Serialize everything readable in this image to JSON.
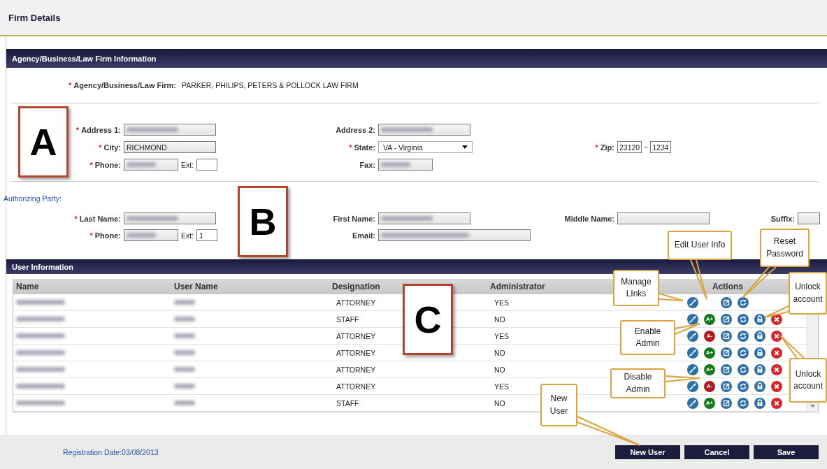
{
  "page_title": "Firm Details",
  "required_marker": "*",
  "firm_section": {
    "title": "Agency/Business/Law Firm Information",
    "firm": {
      "label": "Agency/Business/Law Firm:",
      "required": true,
      "value": "PARKER, PHILIPS, PETERS & POLLOCK LAW FIRM"
    }
  },
  "address_fields": [
    {
      "label": "Address 1:",
      "required": true,
      "kind": "text",
      "redacted": true
    },
    {
      "label": "Address 2:",
      "required": false,
      "kind": "text",
      "redacted": true
    },
    {
      "label": "City:",
      "required": true,
      "kind": "text",
      "value": "RICHMOND"
    },
    {
      "label": "State:",
      "required": true,
      "kind": "select",
      "value": "VA - Virginia"
    },
    {
      "label": "Zip:",
      "required": true,
      "kind": "zip",
      "value": "23120",
      "extension": "1234"
    },
    {
      "label": "Phone:",
      "required": true,
      "kind": "phone",
      "redacted": true,
      "ext_label": "Ext:"
    },
    {
      "label": "Fax:",
      "required": false,
      "kind": "text",
      "redacted": true
    }
  ],
  "authorizing_party": {
    "title": "Authorizing Party:",
    "fields": [
      {
        "label": "Last Name:",
        "required": true,
        "kind": "text",
        "redacted": true
      },
      {
        "label": "First Name:",
        "required": false,
        "kind": "text",
        "redacted": true
      },
      {
        "label": "Middle Name:",
        "required": false,
        "kind": "text"
      },
      {
        "label": "Suffix:",
        "required": false,
        "kind": "text"
      },
      {
        "label": "Phone:",
        "required": true,
        "kind": "phone",
        "redacted": true,
        "ext_label": "Ext:",
        "ext_value": "1"
      },
      {
        "label": "Email:",
        "required": false,
        "kind": "text",
        "redacted": true
      }
    ]
  },
  "user_section": {
    "title": "User Information",
    "columns": [
      "Name",
      "User Name",
      "Designation",
      "Administrator",
      "Actions"
    ],
    "rows": [
      {
        "name_redacted": true,
        "user_name_redacted": true,
        "designation": "ATTORNEY",
        "administrator": "YES",
        "actions": [
          {
            "kind": "link"
          },
          {
            "kind": "gap"
          },
          {
            "kind": "edit"
          },
          {
            "kind": "reset"
          }
        ]
      },
      {
        "name_redacted": true,
        "user_name_redacted": true,
        "designation": "STAFF",
        "administrator": "NO",
        "actions": [
          {
            "kind": "link"
          },
          {
            "kind": "enable_admin",
            "label": "A+"
          },
          {
            "kind": "edit"
          },
          {
            "kind": "reset"
          },
          {
            "kind": "unlock"
          },
          {
            "kind": "delete"
          }
        ]
      },
      {
        "name_redacted": true,
        "user_name_redacted": true,
        "designation": "ATTORNEY",
        "administrator": "YES",
        "actions": [
          {
            "kind": "link"
          },
          {
            "kind": "disable_admin",
            "label": "A-"
          },
          {
            "kind": "edit"
          },
          {
            "kind": "reset"
          },
          {
            "kind": "unlock"
          },
          {
            "kind": "delete"
          }
        ]
      },
      {
        "name_redacted": true,
        "user_name_redacted": true,
        "designation": "ATTORNEY",
        "administrator": "NO",
        "actions": [
          {
            "kind": "link"
          },
          {
            "kind": "enable_admin",
            "label": "A+"
          },
          {
            "kind": "edit"
          },
          {
            "kind": "reset"
          },
          {
            "kind": "unlock"
          },
          {
            "kind": "delete"
          }
        ]
      },
      {
        "name_redacted": true,
        "user_name_redacted": true,
        "designation": "ATTORNEY",
        "administrator": "NO",
        "actions": [
          {
            "kind": "link"
          },
          {
            "kind": "enable_admin",
            "label": "A+"
          },
          {
            "kind": "edit"
          },
          {
            "kind": "reset"
          },
          {
            "kind": "unlock"
          },
          {
            "kind": "delete"
          }
        ]
      },
      {
        "name_redacted": true,
        "user_name_redacted": true,
        "designation": "ATTORNEY",
        "administrator": "YES",
        "actions": [
          {
            "kind": "link"
          },
          {
            "kind": "disable_admin",
            "label": "A-"
          },
          {
            "kind": "edit"
          },
          {
            "kind": "reset"
          },
          {
            "kind": "unlock"
          },
          {
            "kind": "delete"
          }
        ]
      },
      {
        "name_redacted": true,
        "user_name_redacted": true,
        "designation": "STAFF",
        "administrator": "NO",
        "actions": [
          {
            "kind": "link"
          },
          {
            "kind": "enable_admin",
            "label": "A+"
          },
          {
            "kind": "edit"
          },
          {
            "kind": "reset"
          },
          {
            "kind": "unlock"
          },
          {
            "kind": "delete"
          }
        ]
      }
    ]
  },
  "footer": {
    "registration": "Registration Date:03/08/2013",
    "buttons": [
      "New User",
      "Cancel",
      "Save"
    ]
  },
  "markers": [
    "A",
    "B",
    "C"
  ],
  "callouts": [
    "Edit User Info",
    "Reset Password",
    "Manage LInks",
    "Unlock account",
    "Enable Admin",
    "Disable Admin",
    "Unlock account",
    "New User"
  ]
}
